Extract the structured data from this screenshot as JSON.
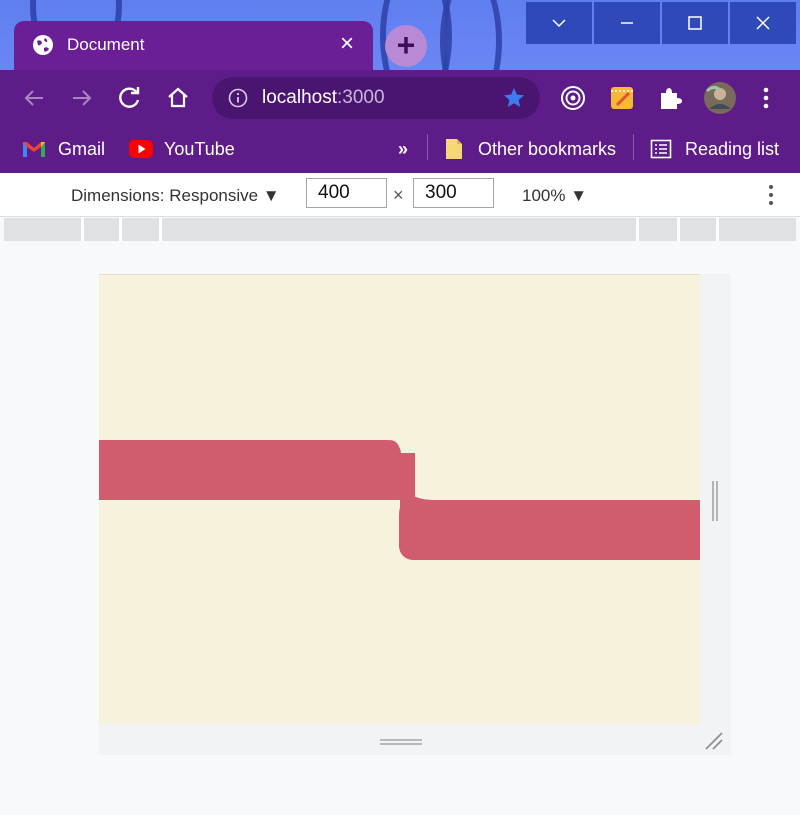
{
  "tab": {
    "title": "Document",
    "close": "×"
  },
  "newtab": {
    "label": "+"
  },
  "toolbar": {
    "url_host": "localhost",
    "url_port": ":3000"
  },
  "bookmarks": {
    "items": [
      {
        "label": "Gmail",
        "icon": "gmail-icon"
      },
      {
        "label": "YouTube",
        "icon": "youtube-icon"
      }
    ],
    "overflow": "»",
    "other": "Other bookmarks",
    "reading_list": "Reading list"
  },
  "devtools": {
    "dimensions_label": "Dimensions: Responsive ▼",
    "width": "400",
    "height": "300",
    "times": "×",
    "zoom": "100% ▼"
  },
  "colors": {
    "titlebar": "#5f7ff0",
    "tab": "#6a1f96",
    "toolbar": "#5d1c87",
    "page_background": "#f7f2db",
    "band": "#d15c6e",
    "star": "#3d7cf0"
  }
}
